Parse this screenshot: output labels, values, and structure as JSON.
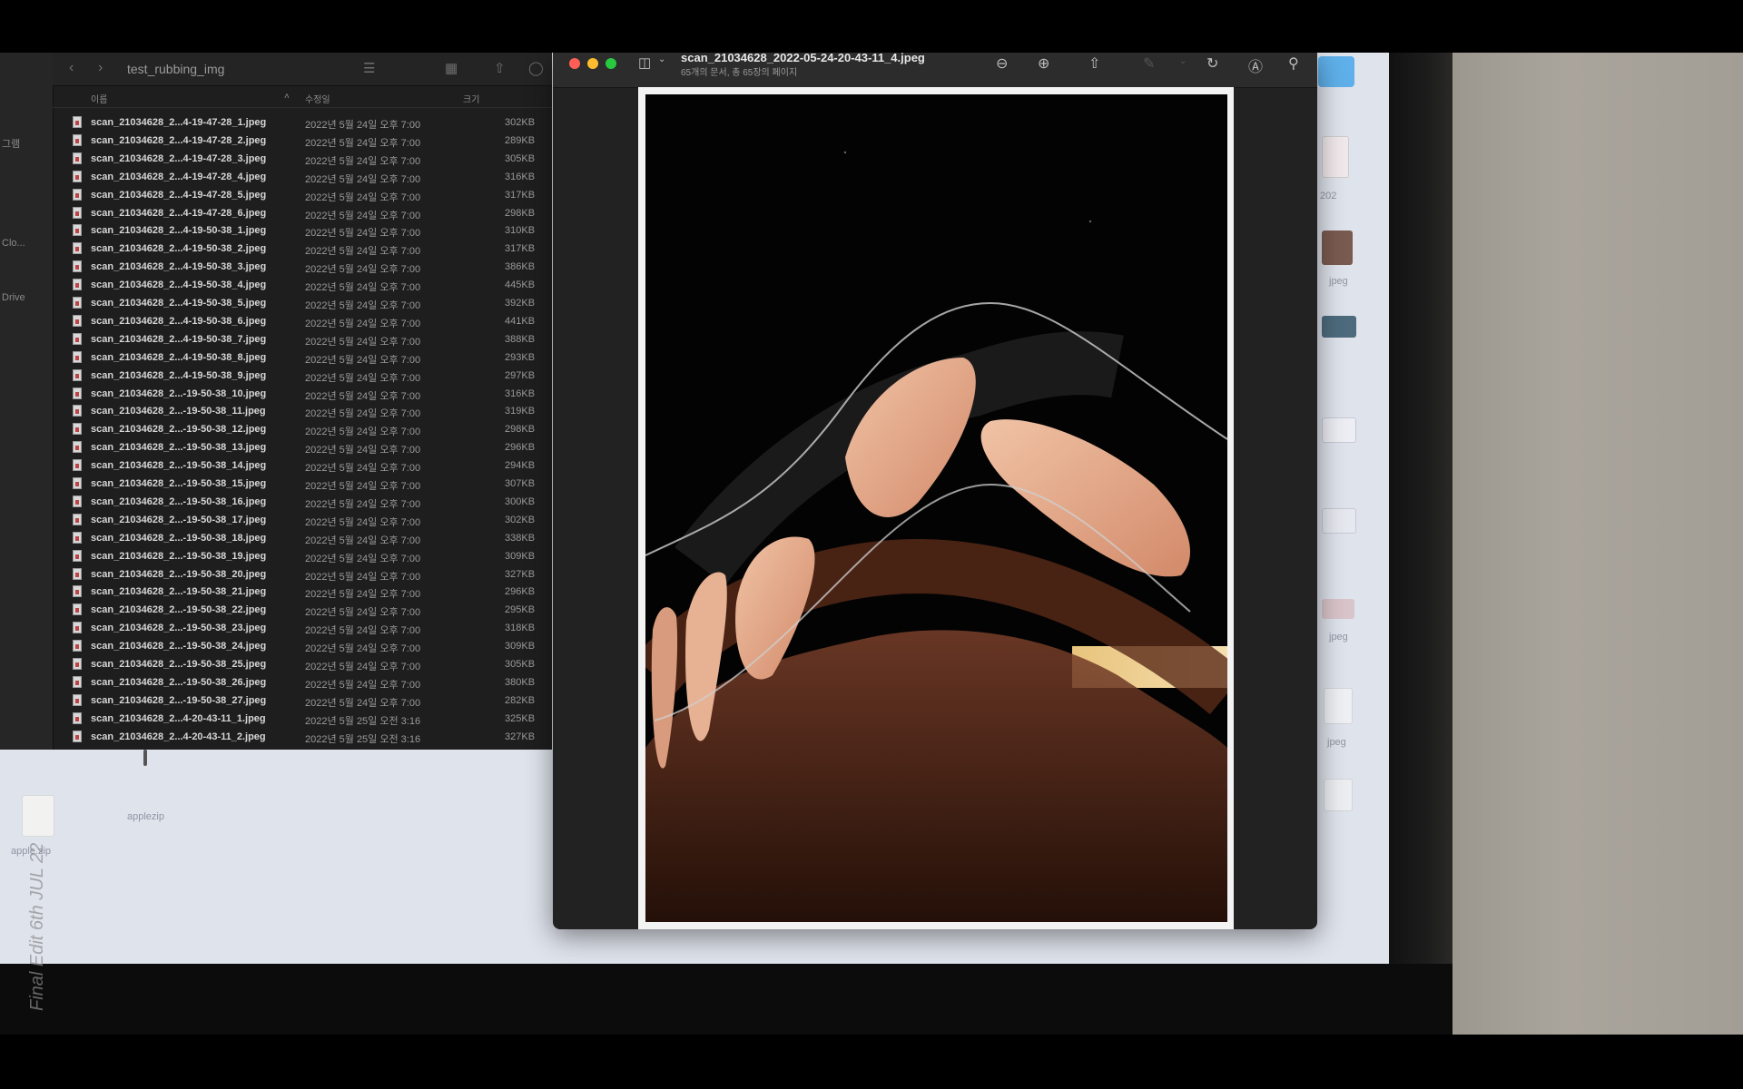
{
  "finder": {
    "folder_title": "test_rubbing_img",
    "sidebar_items": [
      "그램",
      "Clo...",
      "Drive"
    ],
    "columns": {
      "name": "이름",
      "date": "수정일",
      "size": "크기"
    },
    "files": [
      {
        "name": "scan_21034628_2...4-19-47-28_1.jpeg",
        "date": "2022년 5월 24일 오후 7:00",
        "size": "302KB"
      },
      {
        "name": "scan_21034628_2...4-19-47-28_2.jpeg",
        "date": "2022년 5월 24일 오후 7:00",
        "size": "289KB"
      },
      {
        "name": "scan_21034628_2...4-19-47-28_3.jpeg",
        "date": "2022년 5월 24일 오후 7:00",
        "size": "305KB"
      },
      {
        "name": "scan_21034628_2...4-19-47-28_4.jpeg",
        "date": "2022년 5월 24일 오후 7:00",
        "size": "316KB"
      },
      {
        "name": "scan_21034628_2...4-19-47-28_5.jpeg",
        "date": "2022년 5월 24일 오후 7:00",
        "size": "317KB"
      },
      {
        "name": "scan_21034628_2...4-19-47-28_6.jpeg",
        "date": "2022년 5월 24일 오후 7:00",
        "size": "298KB"
      },
      {
        "name": "scan_21034628_2...4-19-50-38_1.jpeg",
        "date": "2022년 5월 24일 오후 7:00",
        "size": "310KB"
      },
      {
        "name": "scan_21034628_2...4-19-50-38_2.jpeg",
        "date": "2022년 5월 24일 오후 7:00",
        "size": "317KB"
      },
      {
        "name": "scan_21034628_2...4-19-50-38_3.jpeg",
        "date": "2022년 5월 24일 오후 7:00",
        "size": "386KB"
      },
      {
        "name": "scan_21034628_2...4-19-50-38_4.jpeg",
        "date": "2022년 5월 24일 오후 7:00",
        "size": "445KB"
      },
      {
        "name": "scan_21034628_2...4-19-50-38_5.jpeg",
        "date": "2022년 5월 24일 오후 7:00",
        "size": "392KB"
      },
      {
        "name": "scan_21034628_2...4-19-50-38_6.jpeg",
        "date": "2022년 5월 24일 오후 7:00",
        "size": "441KB"
      },
      {
        "name": "scan_21034628_2...4-19-50-38_7.jpeg",
        "date": "2022년 5월 24일 오후 7:00",
        "size": "388KB"
      },
      {
        "name": "scan_21034628_2...4-19-50-38_8.jpeg",
        "date": "2022년 5월 24일 오후 7:00",
        "size": "293KB"
      },
      {
        "name": "scan_21034628_2...4-19-50-38_9.jpeg",
        "date": "2022년 5월 24일 오후 7:00",
        "size": "297KB"
      },
      {
        "name": "scan_21034628_2...-19-50-38_10.jpeg",
        "date": "2022년 5월 24일 오후 7:00",
        "size": "316KB"
      },
      {
        "name": "scan_21034628_2...-19-50-38_11.jpeg",
        "date": "2022년 5월 24일 오후 7:00",
        "size": "319KB"
      },
      {
        "name": "scan_21034628_2...-19-50-38_12.jpeg",
        "date": "2022년 5월 24일 오후 7:00",
        "size": "298KB"
      },
      {
        "name": "scan_21034628_2...-19-50-38_13.jpeg",
        "date": "2022년 5월 24일 오후 7:00",
        "size": "296KB"
      },
      {
        "name": "scan_21034628_2...-19-50-38_14.jpeg",
        "date": "2022년 5월 24일 오후 7:00",
        "size": "294KB"
      },
      {
        "name": "scan_21034628_2...-19-50-38_15.jpeg",
        "date": "2022년 5월 24일 오후 7:00",
        "size": "307KB"
      },
      {
        "name": "scan_21034628_2...-19-50-38_16.jpeg",
        "date": "2022년 5월 24일 오후 7:00",
        "size": "300KB"
      },
      {
        "name": "scan_21034628_2...-19-50-38_17.jpeg",
        "date": "2022년 5월 24일 오후 7:00",
        "size": "302KB"
      },
      {
        "name": "scan_21034628_2...-19-50-38_18.jpeg",
        "date": "2022년 5월 24일 오후 7:00",
        "size": "338KB"
      },
      {
        "name": "scan_21034628_2...-19-50-38_19.jpeg",
        "date": "2022년 5월 24일 오후 7:00",
        "size": "309KB"
      },
      {
        "name": "scan_21034628_2...-19-50-38_20.jpeg",
        "date": "2022년 5월 24일 오후 7:00",
        "size": "327KB"
      },
      {
        "name": "scan_21034628_2...-19-50-38_21.jpeg",
        "date": "2022년 5월 24일 오후 7:00",
        "size": "296KB"
      },
      {
        "name": "scan_21034628_2...-19-50-38_22.jpeg",
        "date": "2022년 5월 24일 오후 7:00",
        "size": "295KB"
      },
      {
        "name": "scan_21034628_2...-19-50-38_23.jpeg",
        "date": "2022년 5월 24일 오후 7:00",
        "size": "318KB"
      },
      {
        "name": "scan_21034628_2...-19-50-38_24.jpeg",
        "date": "2022년 5월 24일 오후 7:00",
        "size": "309KB"
      },
      {
        "name": "scan_21034628_2...-19-50-38_25.jpeg",
        "date": "2022년 5월 24일 오후 7:00",
        "size": "305KB"
      },
      {
        "name": "scan_21034628_2...-19-50-38_26.jpeg",
        "date": "2022년 5월 24일 오후 7:00",
        "size": "380KB"
      },
      {
        "name": "scan_21034628_2...-19-50-38_27.jpeg",
        "date": "2022년 5월 24일 오후 7:00",
        "size": "282KB"
      },
      {
        "name": "scan_21034628_2...4-20-43-11_1.jpeg",
        "date": "2022년 5월 25일 오전 3:16",
        "size": "325KB"
      },
      {
        "name": "scan_21034628_2...4-20-43-11_2.jpeg",
        "date": "2022년 5월 25일 오전 3:16",
        "size": "327KB"
      }
    ]
  },
  "preview": {
    "title": "scan_21034628_2022-05-24-20-43-11_4.jpeg",
    "subtitle": "65개의 문서, 총 65장의 페이지"
  },
  "desktop": {
    "left_icons": [
      {
        "label": "apple.zip"
      },
      {
        "label": "applezip"
      }
    ],
    "right_icons": [
      {
        "label": "jpeg"
      },
      {
        "label": "jpeg"
      },
      {
        "label": "jpeg"
      }
    ]
  },
  "overlay": {
    "film_label": "Final Edit 6th JUL 22"
  },
  "colors": {
    "finder_bg": "#1e1e1e",
    "preview_bg": "#222222",
    "desktop_bg": "#dfe3ec",
    "traffic_red": "#ff5f57",
    "traffic_yellow": "#febc2e",
    "traffic_green": "#28c840"
  }
}
